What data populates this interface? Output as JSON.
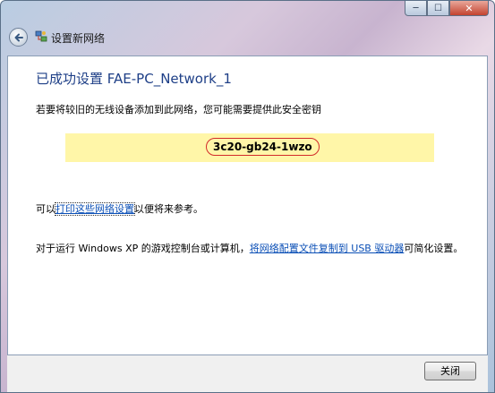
{
  "window": {
    "title": "设置新网络",
    "minimize_glyph": "─",
    "maximize_glyph": "☐",
    "close_glyph": "✕"
  },
  "main": {
    "heading": "已成功设置 FAE-PC_Network_1",
    "description": "若要将较旧的无线设备添加到此网络，您可能需要提供此安全密钥",
    "security_key": "3c20-gb24-1wzo",
    "print_prefix": "可以",
    "print_link": "打印这些网络设置",
    "print_suffix": "以便将来参考。",
    "usb_prefix": "对于运行 Windows XP 的游戏控制台或计算机，",
    "usb_link": "将网络配置文件复制到 USB 驱动器",
    "usb_suffix": "可简化设置。"
  },
  "footer": {
    "close_label": "关闭"
  },
  "colors": {
    "heading": "#1e3f87",
    "key_highlight": "#fff6a8",
    "key_circle": "#d22a2a",
    "link": "#0b4fb6"
  },
  "icons": [
    "back-arrow-icon",
    "network-icon",
    "minimize-icon",
    "maximize-icon",
    "close-icon"
  ]
}
